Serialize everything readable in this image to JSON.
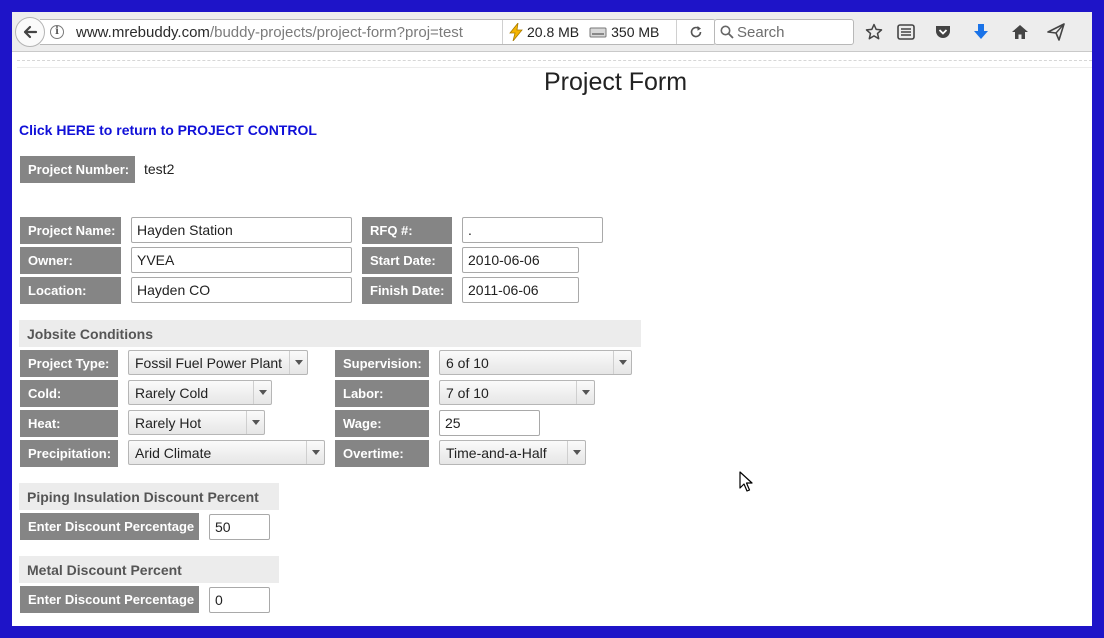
{
  "browser": {
    "url_host": "www.mrebuddy.com",
    "url_path": "/buddy-projects/project-form?proj=test",
    "memory_usage": "20.8 MB",
    "disk_usage": "350 MB",
    "search_placeholder": "Search"
  },
  "page": {
    "title": "Project Form",
    "return_link": "Click HERE to return to PROJECT CONTROL",
    "project_number": {
      "label": "Project Number:",
      "value": "test2"
    },
    "details": {
      "project_name": {
        "label": "Project Name:",
        "value": "Hayden Station"
      },
      "owner": {
        "label": "Owner:",
        "value": "YVEA"
      },
      "location": {
        "label": "Location:",
        "value": "Hayden CO"
      },
      "rfq": {
        "label": "RFQ #:",
        "value": "."
      },
      "start_date": {
        "label": "Start Date:",
        "value": "2010-06-06"
      },
      "finish_date": {
        "label": "Finish Date:",
        "value": "2011-06-06"
      }
    },
    "jobsite": {
      "heading": "Jobsite Conditions",
      "project_type": {
        "label": "Project Type:",
        "value": "Fossil Fuel Power Plant"
      },
      "cold": {
        "label": "Cold:",
        "value": "Rarely Cold"
      },
      "heat": {
        "label": "Heat:",
        "value": "Rarely Hot"
      },
      "precipitation": {
        "label": "Precipitation:",
        "value": "Arid Climate"
      },
      "supervision": {
        "label": "Supervision:",
        "value": "6 of 10"
      },
      "labor": {
        "label": "Labor:",
        "value": "7 of 10"
      },
      "wage": {
        "label": "Wage:",
        "value": "25"
      },
      "overtime": {
        "label": "Overtime:",
        "value": "Time-and-a-Half"
      }
    },
    "piping_discount": {
      "heading": "Piping Insulation Discount Percent",
      "label": "Enter Discount Percentage",
      "value": "50"
    },
    "metal_discount": {
      "heading": "Metal Discount Percent",
      "label": "Enter Discount Percentage",
      "value": "0"
    }
  }
}
